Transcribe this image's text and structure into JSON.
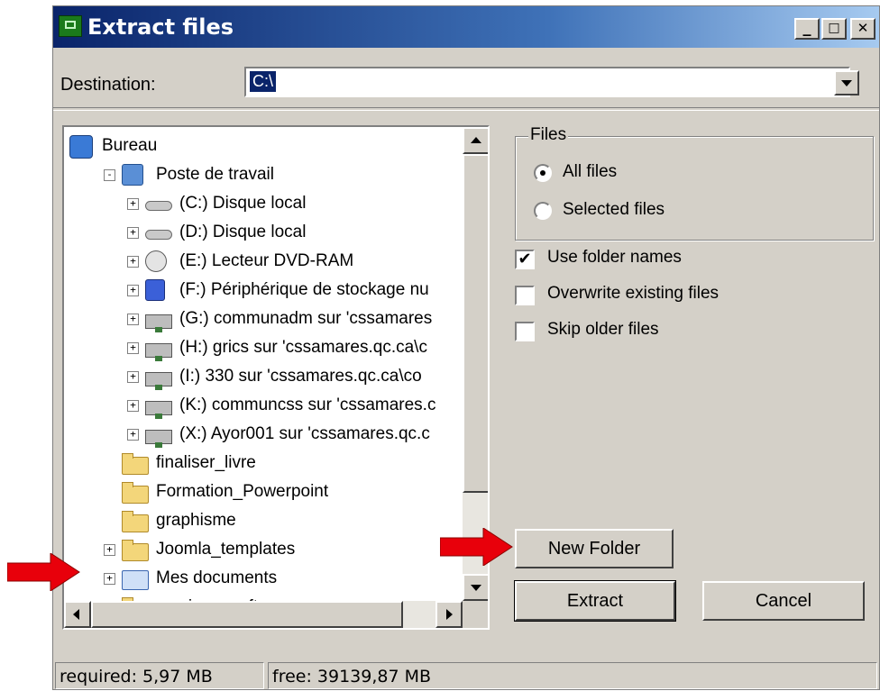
{
  "window": {
    "title": "Extract files",
    "min_glyph": "_",
    "max_glyph": "□",
    "close_glyph": "✕"
  },
  "destination": {
    "label": "Destination:",
    "value": "C:\\"
  },
  "tree": {
    "items": [
      {
        "label": "Bureau",
        "icon": "desktop-icon"
      },
      {
        "label": "Poste de travail",
        "icon": "my-computer-icon"
      },
      {
        "label": "(C:) Disque local",
        "icon": "hard-drive-icon"
      },
      {
        "label": "(D:) Disque local",
        "icon": "hard-drive-icon"
      },
      {
        "label": "(E:) Lecteur DVD-RAM",
        "icon": "dvd-drive-icon"
      },
      {
        "label": "(F:) Périphérique de stockage nu",
        "icon": "usb-storage-icon"
      },
      {
        "label": "(G:) communadm sur 'cssamares",
        "icon": "network-drive-icon"
      },
      {
        "label": "(H:) grics sur 'cssamares.qc.ca\\c",
        "icon": "network-drive-icon"
      },
      {
        "label": "(I:) 330 sur 'cssamares.qc.ca\\co",
        "icon": "network-drive-icon"
      },
      {
        "label": "(K:) communcss sur 'cssamares.c",
        "icon": "network-drive-icon"
      },
      {
        "label": "(X:) Ayor001 sur 'cssamares.qc.c",
        "icon": "network-drive-icon"
      },
      {
        "label": "finaliser_livre",
        "icon": "folder-icon"
      },
      {
        "label": "Formation_Powerpoint",
        "icon": "folder-icon"
      },
      {
        "label": "graphisme",
        "icon": "folder-icon"
      },
      {
        "label": "Joomla_templates",
        "icon": "folder-icon"
      },
      {
        "label": "Mes documents",
        "icon": "my-documents-icon"
      },
      {
        "label": "musique_soft",
        "icon": "folder-icon"
      }
    ]
  },
  "files_group": {
    "title": "Files",
    "all_files": "All files",
    "selected_files": "Selected files",
    "selected": "all_files"
  },
  "options": {
    "use_folder_names": {
      "label": "Use folder names",
      "checked": true
    },
    "overwrite_existing": {
      "label": "Overwrite existing files",
      "checked": false
    },
    "skip_older": {
      "label": "Skip older files",
      "checked": false
    }
  },
  "buttons": {
    "new_folder": "New Folder",
    "extract": "Extract",
    "cancel": "Cancel"
  },
  "status": {
    "required": "required: 5,97 MB",
    "free": "free: 39139,87 MB"
  },
  "colors": {
    "annotation_arrow": "#e8000b",
    "title_gradient_start": "#0a246a",
    "face": "#d4d0c8"
  }
}
